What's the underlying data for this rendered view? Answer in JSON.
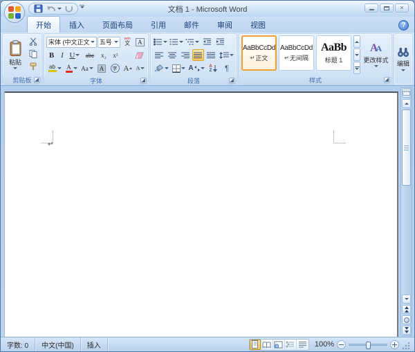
{
  "window": {
    "title": "文档 1 - Microsoft Word"
  },
  "tabs": [
    {
      "label": "开始",
      "active": true
    },
    {
      "label": "插入"
    },
    {
      "label": "页面布局"
    },
    {
      "label": "引用"
    },
    {
      "label": "邮件"
    },
    {
      "label": "审阅"
    },
    {
      "label": "视图"
    }
  ],
  "ribbon": {
    "clipboard": {
      "group_label": "剪贴板",
      "paste_label": "粘贴"
    },
    "font": {
      "group_label": "字体",
      "font_name": "宋体 (中文正文)",
      "font_size": "五号",
      "bold": "B",
      "italic": "I",
      "underline": "U",
      "strikethrough": "abc",
      "subscript": "x₂",
      "superscript": "x²",
      "change_case": "Aa",
      "char_border": "A",
      "char_shading": "A"
    },
    "paragraph": {
      "group_label": "段落"
    },
    "styles": {
      "group_label": "样式",
      "change_styles_label": "更改样式",
      "items": [
        {
          "preview": "AaBbCcDd",
          "prefix": "↵",
          "name": "正文",
          "selected": true
        },
        {
          "preview": "AaBbCcDd",
          "prefix": "↵",
          "name": "无间隔"
        },
        {
          "preview": "AaBb",
          "prefix": "",
          "name": "标题 1"
        }
      ]
    },
    "editing": {
      "group_label": "编辑"
    }
  },
  "document": {
    "paragraph_mark": "↵"
  },
  "statusbar": {
    "word_count": "字数: 0",
    "language": "中文(中国)",
    "insert_mode": "插入",
    "zoom_level": "100%"
  },
  "icons": {
    "close": "×",
    "help": "?",
    "pilcrow": "¶",
    "letter_a": "A",
    "highlight_ab": "ab",
    "circled_char": "字",
    "sort_top": "A",
    "sort_bottom": "Z",
    "pinyin_top": "wén",
    "pinyin_char": "文",
    "asian_layout": "A"
  },
  "colors": {
    "accent_selected": "#f0a030",
    "active_toggle": "#f9c457",
    "titlebar_blue": "#bcd7f2",
    "tab_text": "#15428b"
  }
}
